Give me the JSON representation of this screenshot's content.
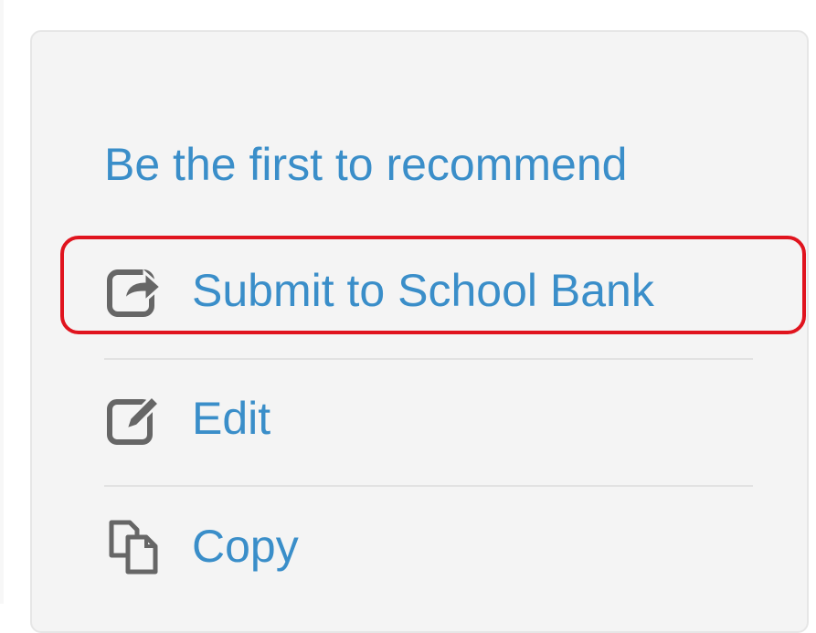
{
  "recommend_link": "Be the first to recommend",
  "actions": [
    {
      "label": "Submit to School Bank",
      "icon": "share-arrow-icon"
    },
    {
      "label": "Edit",
      "icon": "edit-pencil-icon"
    },
    {
      "label": "Copy",
      "icon": "copy-documents-icon"
    }
  ],
  "colors": {
    "link": "#3a8ec9",
    "icon": "#666666",
    "highlight": "#e0141e",
    "panel_bg": "#f4f4f4"
  }
}
